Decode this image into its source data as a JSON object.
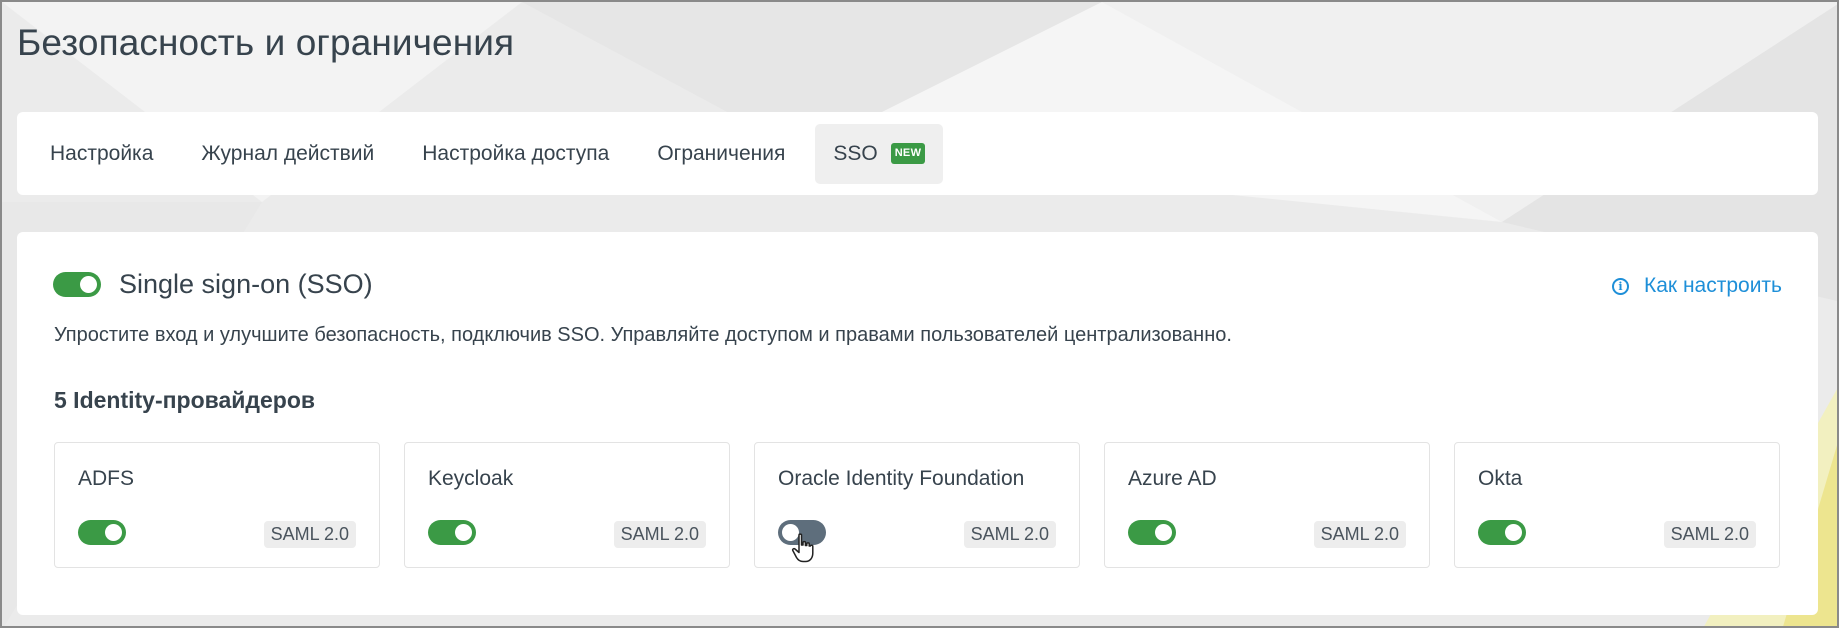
{
  "page_title": "Безопасность и ограничения",
  "tabs": [
    {
      "label": "Настройка",
      "active": false
    },
    {
      "label": "Журнал действий",
      "active": false
    },
    {
      "label": "Настройка доступа",
      "active": false
    },
    {
      "label": "Ограничения",
      "active": false
    },
    {
      "label": "SSO",
      "active": true,
      "badge": "NEW"
    }
  ],
  "sso": {
    "title": "Single sign-on (SSO)",
    "enabled": true,
    "how_to_label": "Как настроить",
    "description": "Упростите вход и улучшите безопасность, подключив SSO. Управляйте доступом и правами пользователей централизованно.",
    "providers_count_label": "5 Identity-провайдеров",
    "providers": [
      {
        "name": "ADFS",
        "enabled": true,
        "protocol": "SAML 2.0"
      },
      {
        "name": "Keycloak",
        "enabled": true,
        "protocol": "SAML 2.0"
      },
      {
        "name": "Oracle Identity Foundation",
        "enabled": false,
        "protocol": "SAML 2.0"
      },
      {
        "name": "Azure AD",
        "enabled": true,
        "protocol": "SAML 2.0"
      },
      {
        "name": "Okta",
        "enabled": true,
        "protocol": "SAML 2.0"
      }
    ]
  },
  "icons": {
    "info": "info-icon",
    "cursor": "hand-pointer-icon"
  },
  "colors": {
    "toggle_on": "#3b9a45",
    "toggle_off": "#5e6e7c",
    "link": "#1e8fd8",
    "badge": "#3b9a45",
    "text": "#37434d"
  }
}
